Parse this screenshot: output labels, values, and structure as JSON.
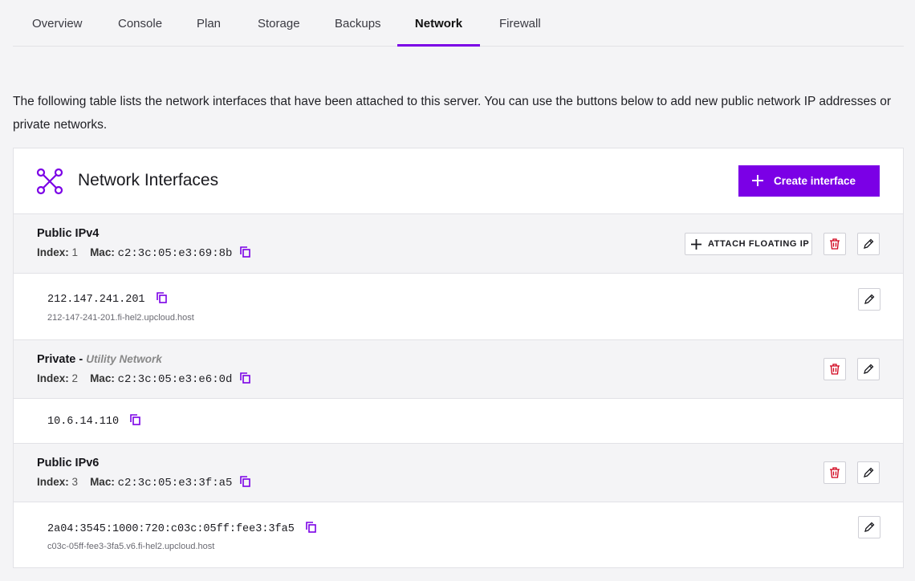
{
  "tabs": [
    {
      "label": "Overview",
      "active": false
    },
    {
      "label": "Console",
      "active": false
    },
    {
      "label": "Plan",
      "active": false
    },
    {
      "label": "Storage",
      "active": false
    },
    {
      "label": "Backups",
      "active": false
    },
    {
      "label": "Network",
      "active": true
    },
    {
      "label": "Firewall",
      "active": false
    }
  ],
  "intro": "The following table lists the network interfaces that have been attached to this server. You can use the buttons below to add new public network IP addresses or private networks.",
  "panel": {
    "title": "Network Interfaces",
    "icon": "network-nodes-icon",
    "create_label": "Create interface"
  },
  "labels": {
    "index": "Index:",
    "mac": "Mac:",
    "attach_floating_ip": "ATTACH FLOATING IP"
  },
  "interfaces": [
    {
      "name": "Public IPv4",
      "name_sub": "",
      "index": "1",
      "mac": "c2:3c:05:e3:69:8b",
      "address": "212.147.241.201",
      "hostname": "212-147-241-201.fi-hel2.upcloud.host"
    },
    {
      "name": "Private - ",
      "name_sub": "Utility Network",
      "index": "2",
      "mac": "c2:3c:05:e3:e6:0d",
      "address": "10.6.14.110",
      "hostname": ""
    },
    {
      "name": "Public IPv6",
      "name_sub": "",
      "index": "3",
      "mac": "c2:3c:05:e3:3f:a5",
      "address": "2a04:3545:1000:720:c03c:05ff:fee3:3fa5",
      "hostname": "c03c-05ff-fee3-3fa5.v6.fi-hel2.upcloud.host"
    }
  ],
  "colors": {
    "accent": "#7b00e6",
    "danger": "#d0021b"
  }
}
